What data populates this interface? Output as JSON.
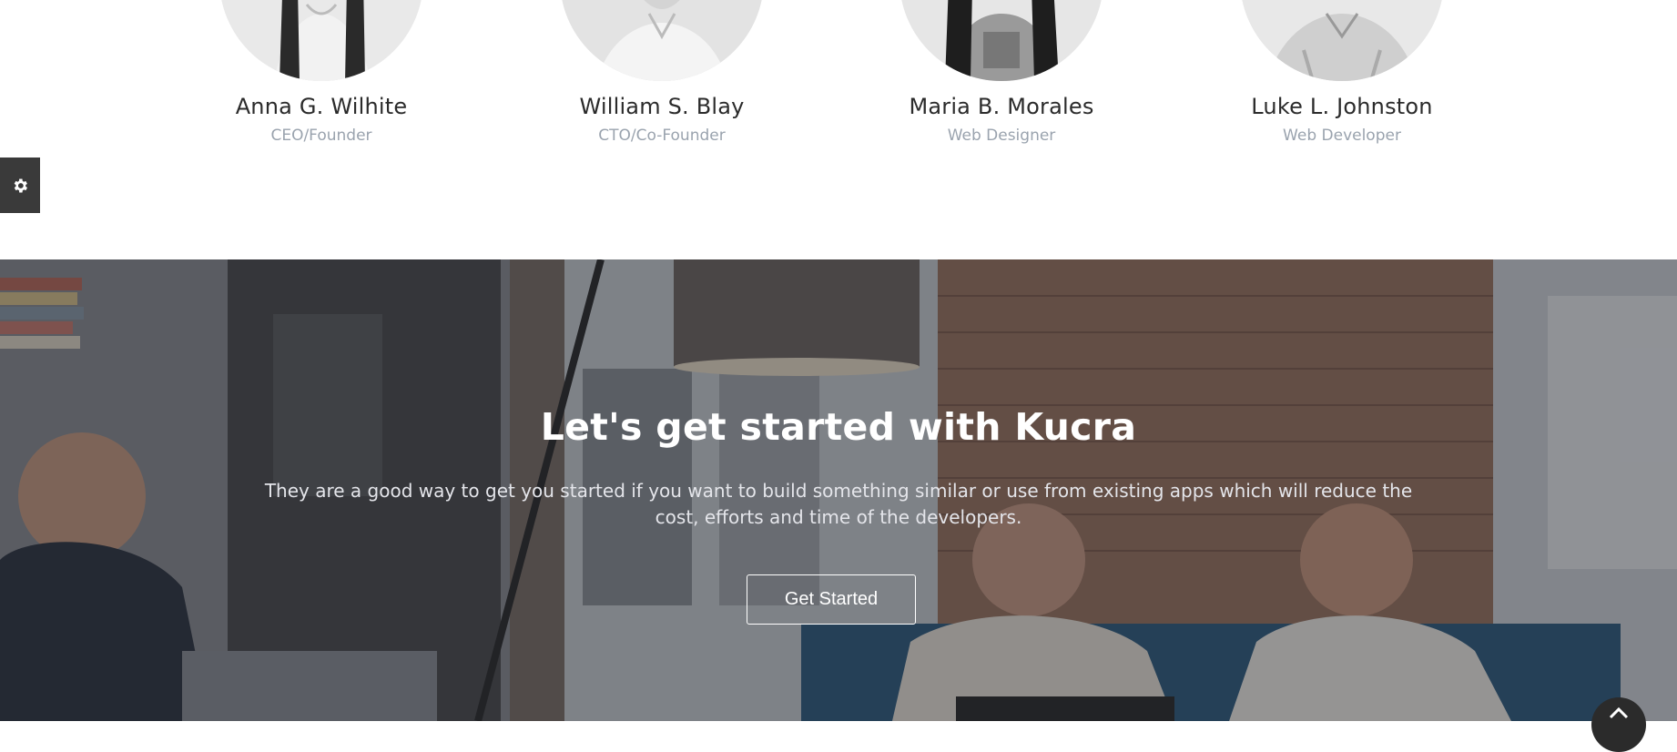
{
  "team": {
    "members": [
      {
        "name": "Anna G. Wilhite",
        "role": "CEO/Founder"
      },
      {
        "name": "William S. Blay",
        "role": "CTO/Co-Founder"
      },
      {
        "name": "Maria B. Morales",
        "role": "Web Designer"
      },
      {
        "name": "Luke L. Johnston",
        "role": "Web Developer"
      }
    ]
  },
  "settings": {
    "icon": "gear-icon"
  },
  "cta": {
    "title": "Let's get started with Kucra",
    "description": "They are a good way to get you started if you want to build something similar or use from existing apps which will reduce the cost, efforts and time of the developers.",
    "button_label": "Get Started"
  },
  "scroll_top": {
    "icon": "chevron-up-icon"
  }
}
